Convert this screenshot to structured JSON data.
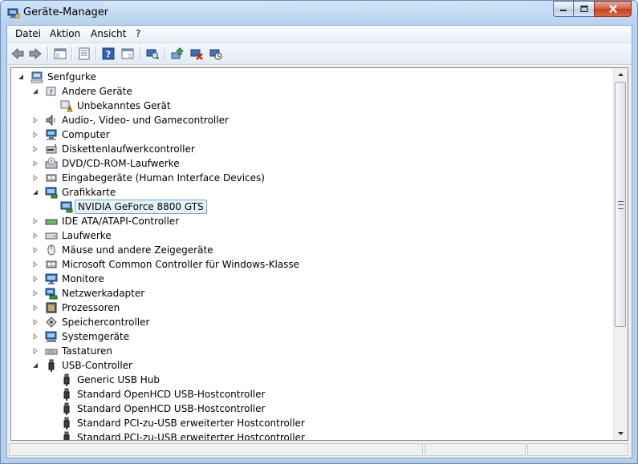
{
  "window": {
    "title": "Geräte-Manager",
    "ghost_url": "http://www.gruselfreunde-forum.de/index.php?form=PostAdd&threadID=1"
  },
  "menu": [
    {
      "label": "Datei"
    },
    {
      "label": "Aktion"
    },
    {
      "label": "Ansicht"
    },
    {
      "label": "?"
    }
  ],
  "toolbar": {
    "buttons": [
      "back-icon",
      "forward-icon",
      "up-tree-icon",
      "properties-icon",
      "help-icon",
      "show-console-icon",
      "scan-hardware-icon",
      "update-driver-icon",
      "uninstall-icon",
      "disable-icon"
    ]
  },
  "tree": {
    "root": "Senfgurke",
    "nodes": [
      {
        "label": "Andere Geräte",
        "expanded": true,
        "level": 1,
        "icon": "unknown-device-icon"
      },
      {
        "label": "Unbekanntes Gerät",
        "level": 2,
        "icon": "warning-device-icon"
      },
      {
        "label": "Audio-, Video- und Gamecontroller",
        "level": 1,
        "icon": "speaker-icon"
      },
      {
        "label": "Computer",
        "level": 1,
        "icon": "computer-icon"
      },
      {
        "label": "Diskettenlaufwerkcontroller",
        "level": 1,
        "icon": "floppy-controller-icon"
      },
      {
        "label": "DVD/CD-ROM-Laufwerke",
        "level": 1,
        "icon": "dvd-drive-icon"
      },
      {
        "label": "Eingabegeräte (Human Interface Devices)",
        "level": 1,
        "icon": "hid-icon"
      },
      {
        "label": "Grafikkarte",
        "expanded": true,
        "level": 1,
        "icon": "display-adapter-icon"
      },
      {
        "label": "NVIDIA GeForce 8800 GTS",
        "level": 2,
        "selected": true,
        "icon": "display-adapter-icon"
      },
      {
        "label": "IDE ATA/ATAPI-Controller",
        "level": 1,
        "icon": "ide-controller-icon"
      },
      {
        "label": "Laufwerke",
        "level": 1,
        "icon": "disk-drive-icon"
      },
      {
        "label": "Mäuse und andere Zeigegeräte",
        "level": 1,
        "icon": "mouse-icon"
      },
      {
        "label": "Microsoft Common Controller für Windows-Klasse",
        "level": 1,
        "icon": "hid-icon"
      },
      {
        "label": "Monitore",
        "level": 1,
        "icon": "monitor-icon"
      },
      {
        "label": "Netzwerkadapter",
        "level": 1,
        "icon": "network-adapter-icon"
      },
      {
        "label": "Prozessoren",
        "level": 1,
        "icon": "processor-icon"
      },
      {
        "label": "Speichercontroller",
        "level": 1,
        "icon": "storage-controller-icon"
      },
      {
        "label": "Systemgeräte",
        "level": 1,
        "icon": "system-devices-icon"
      },
      {
        "label": "Tastaturen",
        "level": 1,
        "icon": "keyboard-icon"
      },
      {
        "label": "USB-Controller",
        "expanded": true,
        "level": 1,
        "icon": "usb-icon"
      },
      {
        "label": "Generic USB Hub",
        "level": 2,
        "icon": "usb-icon"
      },
      {
        "label": "Standard OpenHCD USB-Hostcontroller",
        "level": 2,
        "icon": "usb-icon"
      },
      {
        "label": "Standard OpenHCD USB-Hostcontroller",
        "level": 2,
        "icon": "usb-icon"
      },
      {
        "label": "Standard PCI-zu-USB erweiterter Hostcontroller",
        "level": 2,
        "icon": "usb-icon"
      },
      {
        "label": "Standard PCI-zu-USB erweiterter Hostcontroller",
        "level": 2,
        "icon": "usb-icon"
      }
    ]
  },
  "colors": {
    "selection_bg": "#e5f3fb",
    "selection_border": "#7da2ce",
    "frame": "#b7d2ee"
  }
}
